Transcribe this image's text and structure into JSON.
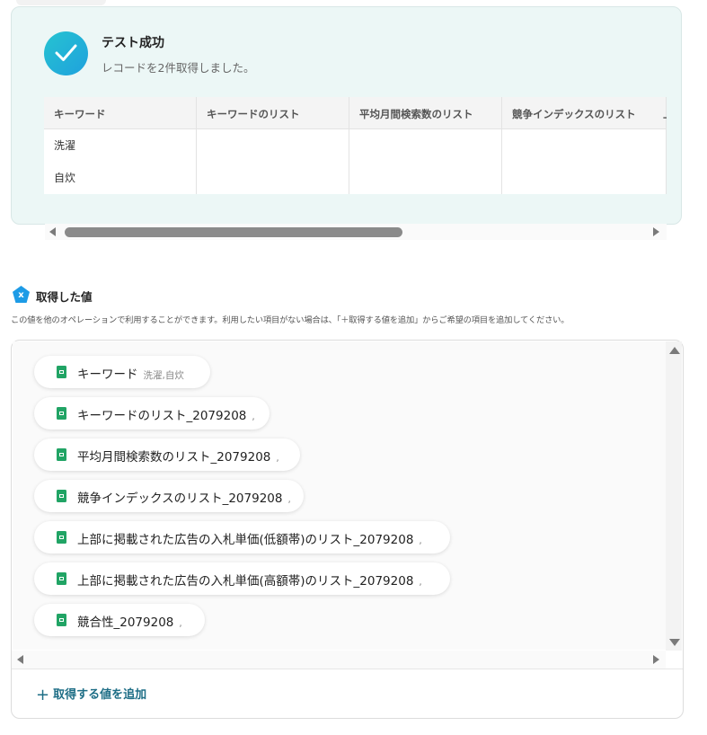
{
  "test_result": {
    "title": "テスト成功",
    "subtitle": "レコードを2件取得しました。",
    "columns": [
      "キーワード",
      "キーワードのリスト",
      "平均月間検索数のリスト",
      "競争インデックスのリスト",
      "上"
    ],
    "rows": [
      [
        "洗濯",
        "",
        "",
        ""
      ],
      [
        "自炊",
        "",
        "",
        ""
      ]
    ]
  },
  "acquired": {
    "title": "取得した値",
    "description": "この値を他のオペレーションで利用することができます。利用したい項目がない場合は、「＋取得する値を追加」からご希望の項目を追加してください。",
    "items": [
      {
        "label": "キーワード",
        "extra": "洗濯,自炊"
      },
      {
        "label": "キーワードのリスト_2079208",
        "extra": ","
      },
      {
        "label": "平均月間検索数のリスト_2079208",
        "extra": ","
      },
      {
        "label": "競争インデックスのリスト_2079208",
        "extra": ","
      },
      {
        "label": "上部に掲載された広告の入札単価(低額帯)のリスト_2079208",
        "extra": ","
      },
      {
        "label": "上部に掲載された広告の入札単価(高額帯)のリスト_2079208",
        "extra": ","
      },
      {
        "label": "競合性_2079208",
        "extra": ","
      }
    ],
    "add_label": "取得する値を追加"
  },
  "colors": {
    "success_bg": "#ecf7f6",
    "check_gradient_start": "#26c3d1",
    "check_gradient_end": "#1fa1dd",
    "sheet_icon": "#21a465",
    "add_link": "#1e6e86",
    "section_icon": "#1d9be6"
  },
  "icons": {
    "success": "check-circle-icon",
    "section": "pentagon-x-icon",
    "chip": "spreadsheet-icon",
    "add": "plus-icon"
  }
}
